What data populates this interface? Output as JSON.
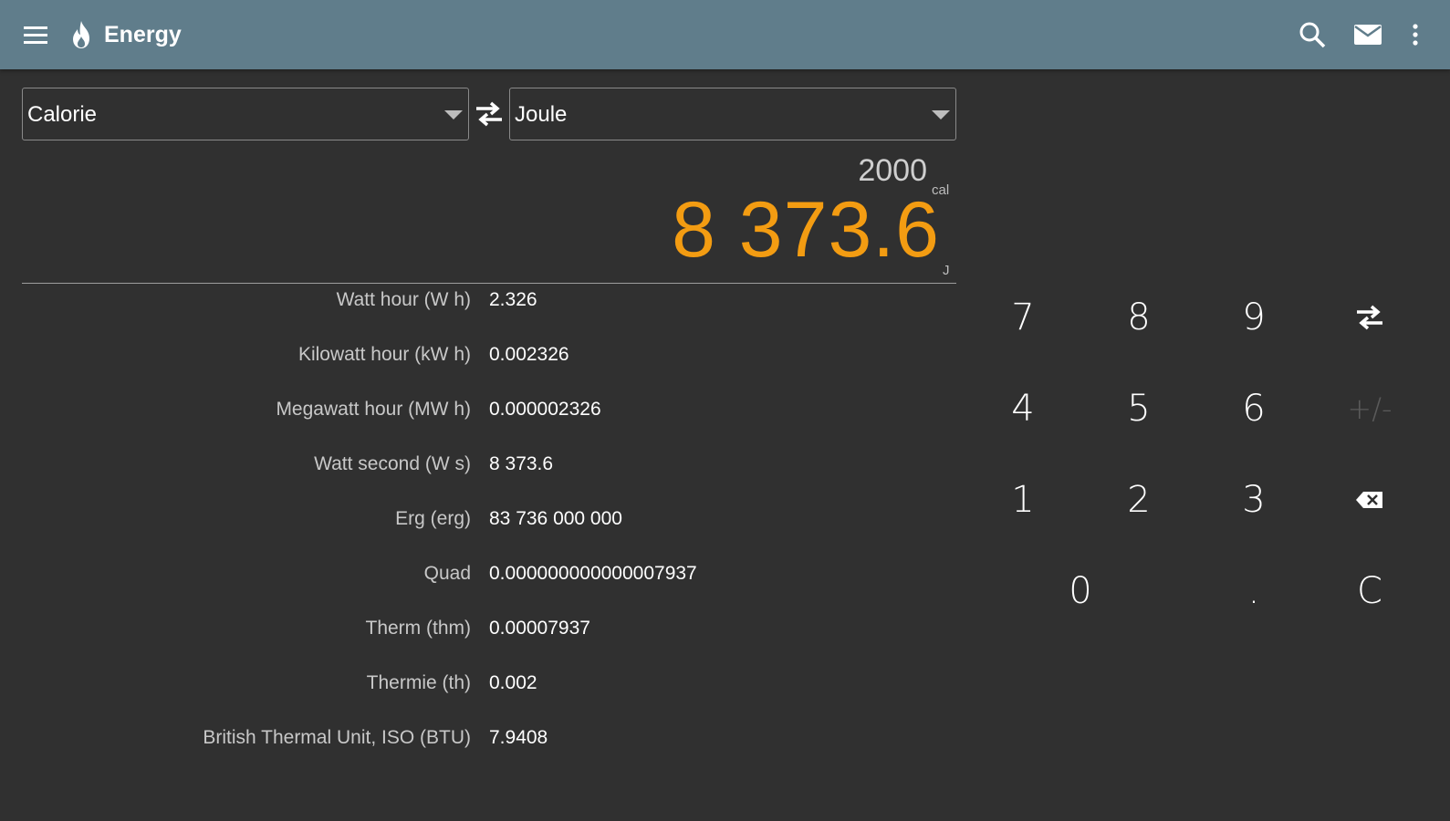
{
  "toolbar": {
    "title": "Energy",
    "icons": [
      "menu-icon",
      "flame-icon",
      "search-icon",
      "mail-icon",
      "overflow-menu-icon"
    ],
    "background": "#607d8b"
  },
  "converter": {
    "from_unit": "Calorie",
    "to_unit": "Joule",
    "input_value": "2000",
    "input_unit": "cal",
    "result_value": "8 373.6",
    "result_unit": "J",
    "result_color": "#f39c12"
  },
  "results": [
    {
      "label": "Watt hour  (W h)",
      "value": "2.326"
    },
    {
      "label": "Kilowatt hour  (kW h)",
      "value": "0.002326"
    },
    {
      "label": "Megawatt hour  (MW h)",
      "value": "0.000002326"
    },
    {
      "label": "Watt second  (W s)",
      "value": "8 373.6"
    },
    {
      "label": "Erg  (erg)",
      "value": "83 736 000 000"
    },
    {
      "label": "Quad",
      "value": "0.000000000000007937"
    },
    {
      "label": "Therm  (thm)",
      "value": "0.00007937"
    },
    {
      "label": "Thermie  (th)",
      "value": "0.002"
    },
    {
      "label": "British Thermal Unit, ISO  (BTU)",
      "value": "7.9408"
    }
  ],
  "keypad": {
    "k7": "7",
    "k8": "8",
    "k9": "9",
    "k4": "4",
    "k5": "5",
    "k6": "6",
    "plusminus": "+/-",
    "k1": "1",
    "k2": "2",
    "k3": "3",
    "k0": "0",
    "dot": ".",
    "clear": "C"
  }
}
